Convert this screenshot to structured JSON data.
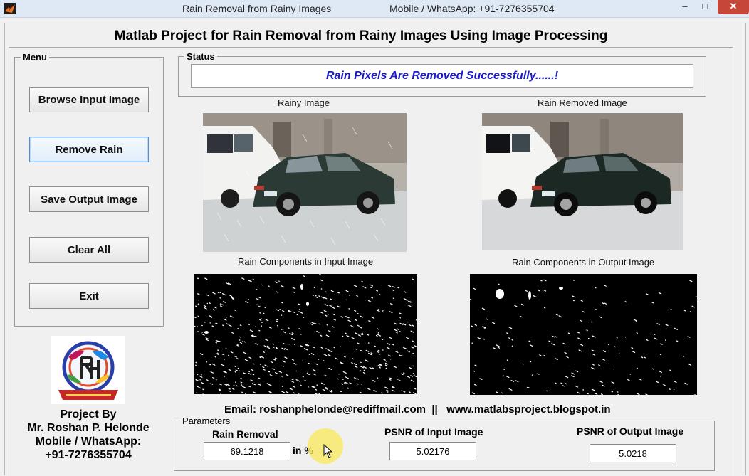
{
  "window": {
    "title": "Rain Removal from Rainy Images",
    "title_contact": "Mobile / WhatsApp: +91-7276355704",
    "minimize_glyph": "–",
    "maximize_glyph": "□",
    "close_glyph": "✕"
  },
  "heading": "Matlab Project for Rain Removal from Rainy Images Using Image Processing",
  "menu": {
    "legend": "Menu",
    "buttons": [
      {
        "label": "Browse Input Image"
      },
      {
        "label": "Remove Rain"
      },
      {
        "label": "Save Output Image"
      },
      {
        "label": "Clear All"
      },
      {
        "label": "Exit"
      }
    ]
  },
  "status": {
    "legend": "Status",
    "message": "Rain Pixels Are Removed Successfully......!"
  },
  "images": {
    "rainy_caption": "Rainy Image",
    "removed_caption": "Rain Removed Image",
    "rain_input_caption": "Rain Components in Input Image",
    "rain_output_caption": "Rain Components in Output Image"
  },
  "credits": {
    "line1": "Project By",
    "line2": "Mr. Roshan P. Helonde",
    "line3": "Mobile / WhatsApp:",
    "line4": "+91-7276355704"
  },
  "contact": "Email: roshanphelonde@rediffmail.com  ||   www.matlabsproject.blogspot.in",
  "parameters": {
    "legend": "Parameters",
    "rain_removal_label": "Rain Removal",
    "rain_removal_value": "69.1218",
    "rain_removal_unit": "in %",
    "psnr_input_label": "PSNR of Input Image",
    "psnr_input_value": "5.02176",
    "psnr_output_label": "PSNR of Output Image",
    "psnr_output_value": "5.0218"
  },
  "colors": {
    "status_text": "#1a1ac8",
    "close_button": "#c7463a",
    "titlebar": "#dfe9f5"
  }
}
